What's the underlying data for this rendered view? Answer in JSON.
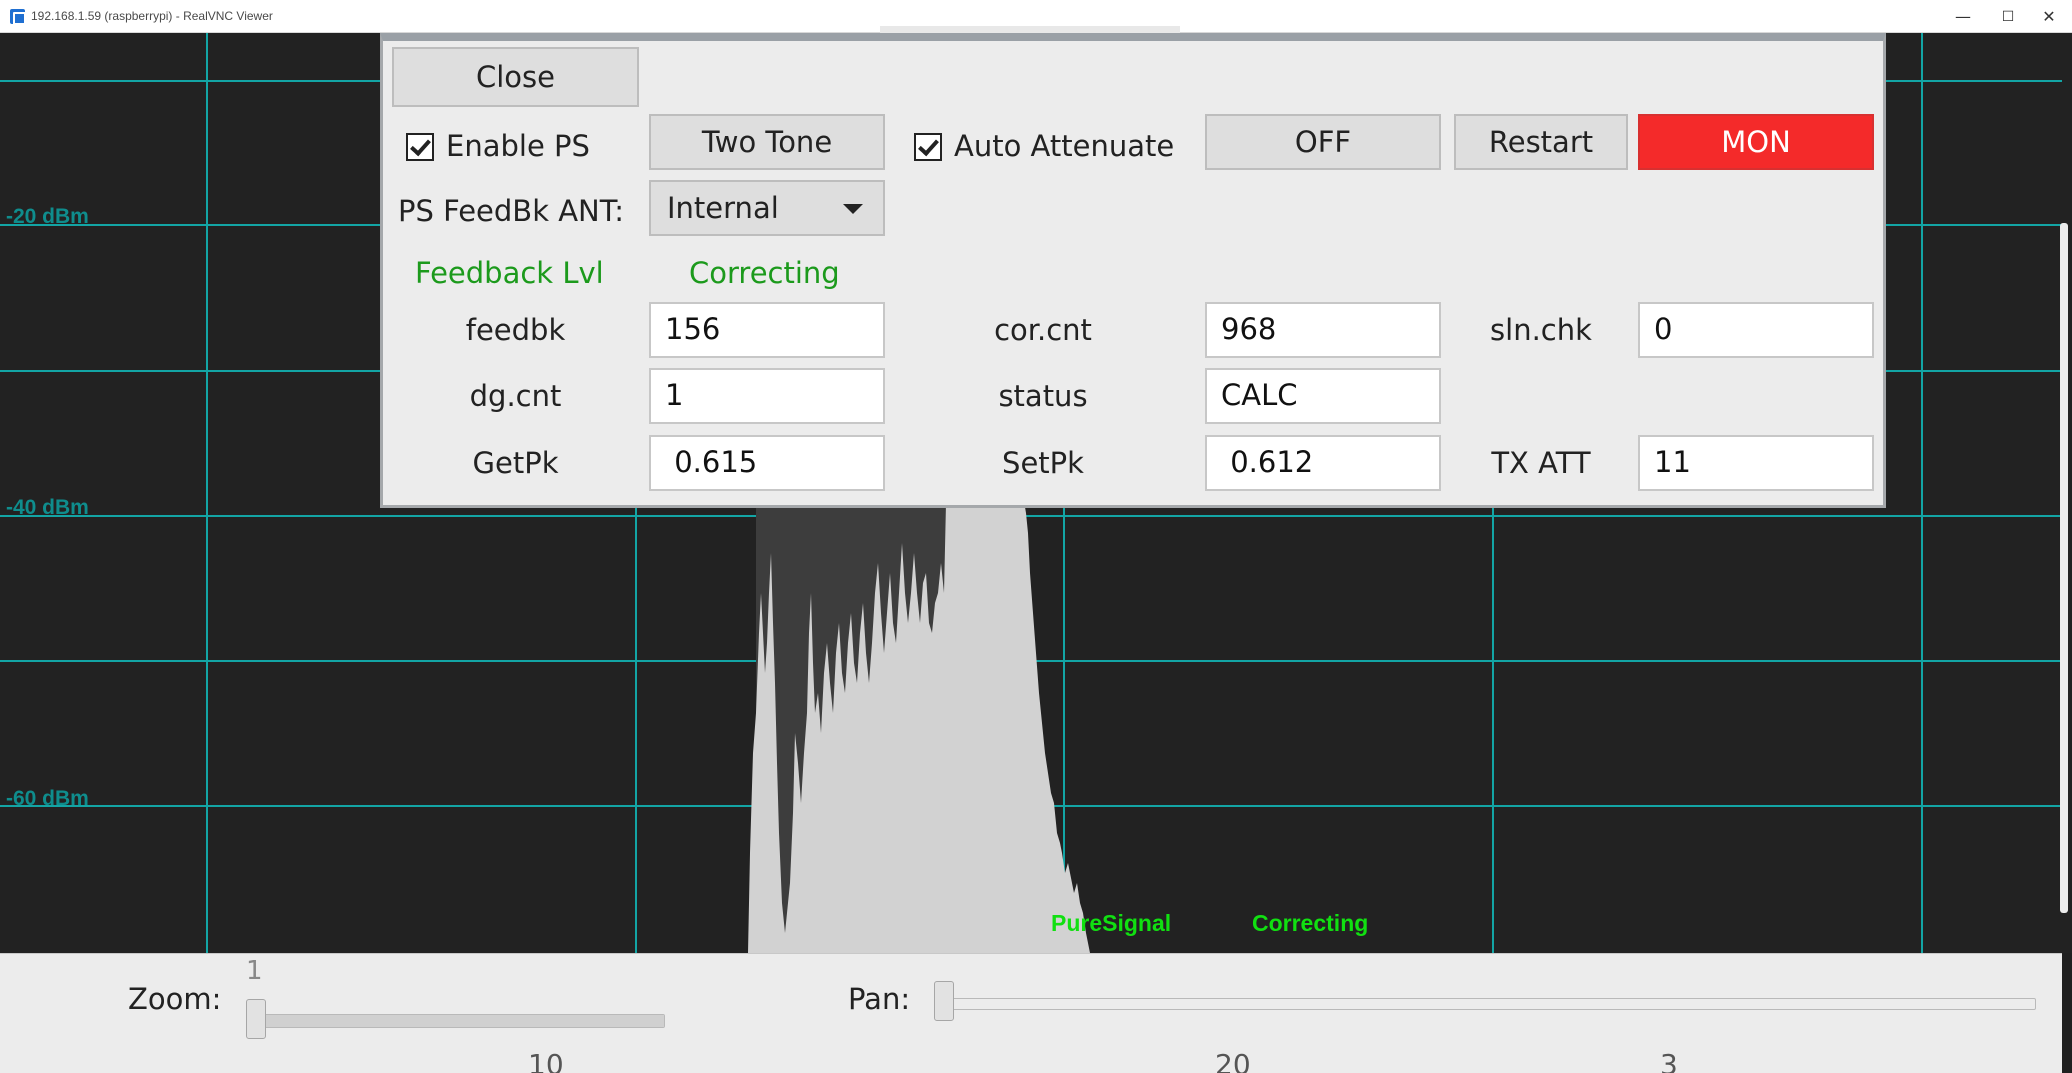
{
  "window": {
    "title": "192.168.1.59 (raspberrypi) - RealVNC Viewer",
    "controls": {
      "minimize": "—",
      "maximize": "☐",
      "close": "✕"
    }
  },
  "scope": {
    "dbm_labels": [
      "-20 dBm",
      "-40 dBm",
      "-60 dBm"
    ],
    "status_left": "PureSignal",
    "status_right": "Correcting"
  },
  "bottom": {
    "zoom_label": "Zoom:",
    "zoom_value": "1",
    "pan_label": "Pan:",
    "freq_labels": [
      "10",
      "20",
      "3"
    ]
  },
  "dialog": {
    "close_button": "Close",
    "enable_ps": {
      "label": "Enable PS",
      "checked": true
    },
    "two_tone_button": "Two Tone",
    "auto_attenuate": {
      "label": "Auto Attenuate",
      "checked": true
    },
    "off_button": "OFF",
    "restart_button": "Restart",
    "mon_button": "MON",
    "feedbk_ant_label": "PS FeedBk ANT:",
    "feedbk_ant_value": "Internal",
    "feedback_lvl": "Feedback Lvl",
    "correcting": "Correcting",
    "fields": {
      "feedbk": {
        "label": "feedbk",
        "value": "156"
      },
      "cor_cnt": {
        "label": "cor.cnt",
        "value": "968"
      },
      "sln_chk": {
        "label": "sln.chk",
        "value": "0"
      },
      "dg_cnt": {
        "label": "dg.cnt",
        "value": "1"
      },
      "status": {
        "label": "status",
        "value": "CALC"
      },
      "getpk": {
        "label": "GetPk",
        "value": " 0.615"
      },
      "setpk": {
        "label": "SetPk",
        "value": " 0.612"
      },
      "tx_att": {
        "label": "TX ATT",
        "value": "11"
      }
    }
  }
}
